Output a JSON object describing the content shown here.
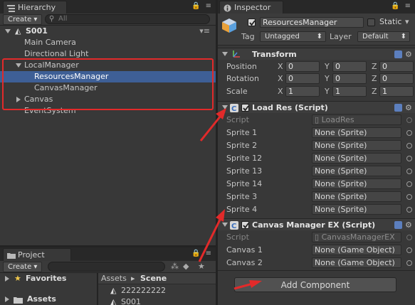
{
  "hierarchy": {
    "tab_label": "Hierarchy",
    "create_label": "Create ▾",
    "search_placeholder": "All",
    "scene_name": "S001",
    "items": [
      {
        "label": "Main Camera"
      },
      {
        "label": "Directional Light"
      },
      {
        "label": "LocalManager"
      },
      {
        "label": "ResourcesManager"
      },
      {
        "label": "CanvasManager"
      },
      {
        "label": "Canvas"
      },
      {
        "label": "EventSystem"
      }
    ]
  },
  "project": {
    "tab_label": "Project",
    "create_label": "Create ▾",
    "favorites_label": "Favorites",
    "assets_label": "Assets",
    "breadcrumb_root": "Assets",
    "breadcrumb_sep": "▸",
    "breadcrumb_current": "Scene",
    "files": [
      "222222222",
      "S001"
    ]
  },
  "inspector": {
    "tab_label": "Inspector",
    "object_name": "ResourcesManager",
    "static_label": "Static",
    "tag_label": "Tag",
    "tag_value": "Untagged",
    "layer_label": "Layer",
    "layer_value": "Default",
    "transform": {
      "title": "Transform",
      "rows": [
        {
          "label": "Position",
          "x": "0",
          "y": "0",
          "z": "0"
        },
        {
          "label": "Rotation",
          "x": "0",
          "y": "0",
          "z": "0"
        },
        {
          "label": "Scale",
          "x": "1",
          "y": "1",
          "z": "1"
        }
      ],
      "axis_x": "X",
      "axis_y": "Y",
      "axis_z": "Z"
    },
    "load_res": {
      "title": "Load Res (Script)",
      "script_label": "Script",
      "script_value": "LoadRes",
      "fields": [
        {
          "label": "Sprite 1",
          "value": "None (Sprite)"
        },
        {
          "label": "Sprite 2",
          "value": "None (Sprite)"
        },
        {
          "label": "Sprite 12",
          "value": "None (Sprite)"
        },
        {
          "label": "Sprite 13",
          "value": "None (Sprite)"
        },
        {
          "label": "Sprite 14",
          "value": "None (Sprite)"
        },
        {
          "label": "Sprite 3",
          "value": "None (Sprite)"
        },
        {
          "label": "Sprite 4",
          "value": "None (Sprite)"
        }
      ]
    },
    "canvas_mgr": {
      "title": "Canvas Manager EX (Script)",
      "script_label": "Script",
      "script_value": "CanvasManagerEX",
      "fields": [
        {
          "label": "Canvas 1",
          "value": "None (Game Object)"
        },
        {
          "label": "Canvas 2",
          "value": "None (Game Object)"
        }
      ]
    },
    "add_component_label": "Add Component"
  },
  "colors": {
    "selection": "#3e5f96",
    "annotation_red": "#e22a2a"
  }
}
